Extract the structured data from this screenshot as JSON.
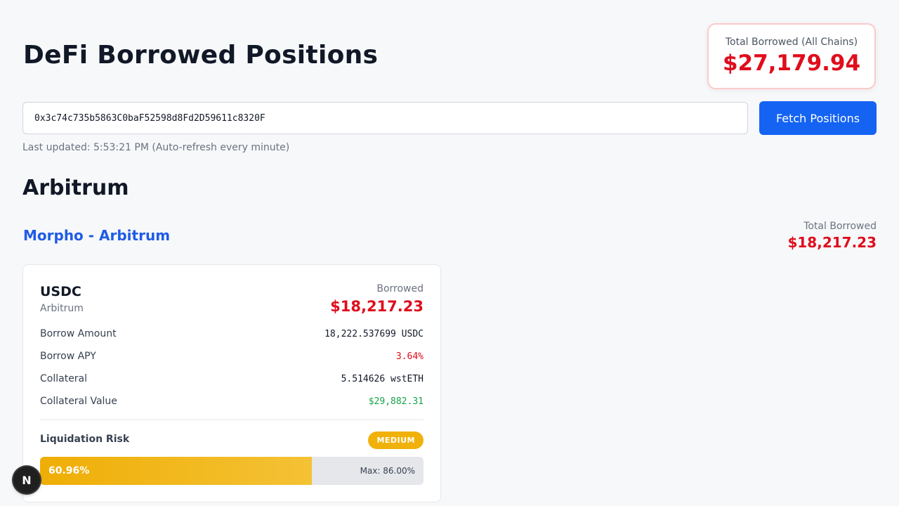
{
  "header": {
    "title": "DeFi Borrowed Positions",
    "total_card": {
      "label": "Total Borrowed (All Chains)",
      "value": "$27,179.94"
    }
  },
  "search": {
    "address_value": "0x3c74c735b5863C0baF52598d8Fd2D59611c8320F",
    "fetch_label": "Fetch Positions",
    "last_updated": "Last updated: 5:53:21 PM (Auto-refresh every minute)"
  },
  "chains": [
    {
      "name": "Arbitrum",
      "protocols": [
        {
          "name": "Morpho - Arbitrum",
          "total_label": "Total Borrowed",
          "total_value": "$18,217.23",
          "positions": [
            {
              "asset": "USDC",
              "chain": "Arbitrum",
              "borrowed_label": "Borrowed",
              "borrowed_value": "$18,217.23",
              "rows": [
                {
                  "label": "Borrow Amount",
                  "value": "18,222.537699 USDC"
                },
                {
                  "label": "Borrow APY",
                  "value": "3.64%"
                },
                {
                  "label": "Collateral",
                  "value": "5.514626 wstETH"
                },
                {
                  "label": "Collateral Value",
                  "value": "$29,882.31"
                }
              ],
              "risk": {
                "label": "Liquidation Risk",
                "level": "MEDIUM",
                "percent_text": "60.96%",
                "percent_value": 60.96,
                "max_text": "Max: 86.00%",
                "max_value": 86.0,
                "badge_color": "#f1b10b"
              }
            }
          ]
        }
      ]
    }
  ],
  "colors": {
    "accent": "#1463f3",
    "negative": "#e00d1c",
    "positive": "#16a34a",
    "protocol_link": "#1f5ce6"
  },
  "dev_badge": {
    "icon": "nextjs-logo-icon",
    "letter": "N"
  }
}
